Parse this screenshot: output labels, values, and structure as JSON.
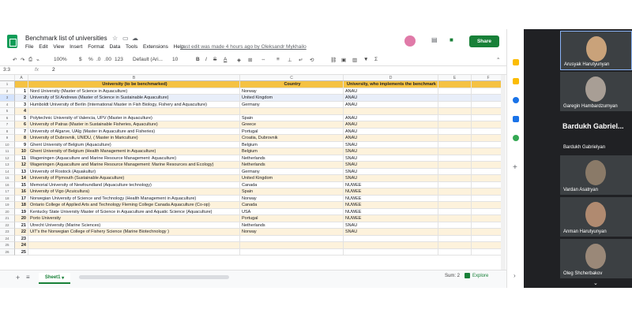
{
  "app": {
    "title": "Benchmark list of universities",
    "menus": [
      "File",
      "Edit",
      "View",
      "Insert",
      "Format",
      "Data",
      "Tools",
      "Extensions",
      "Help"
    ],
    "last_edit": "Last edit was made 4 hours ago by Oleksandr Mykhailo",
    "share_label": "Share"
  },
  "toolbar": {
    "zoom": "100%",
    "currency": "$",
    "percent": "%",
    "decimal_less": ".0",
    "decimal_more": ".00",
    "number_format": "123",
    "font": "Default (Ari...",
    "font_size": "10"
  },
  "formula": {
    "name_box": "3:3",
    "fx": "fx",
    "value": "2"
  },
  "columns": [
    "A",
    "B",
    "C",
    "D",
    "E",
    "F"
  ],
  "header": {
    "b": "University (to be benchmarked)",
    "c": "Country",
    "d": "University, who implements the benchmark"
  },
  "rows": [
    {
      "r": "2",
      "n": "1",
      "b": "Nord University (Master of Science in Aquaculture)",
      "c": "Norway",
      "d": "ANAU"
    },
    {
      "r": "3",
      "n": "2",
      "b": "University of St Andrews (Master of Science in Sustainable Aquaculture)",
      "c": "United Kingdom",
      "d": "ANAU"
    },
    {
      "r": "4",
      "n": "3",
      "b": "Humboldt University of Berlin (International Master in Fish Biology, Fishery and Aquaculture)",
      "c": "Germany",
      "d": "ANAU"
    },
    {
      "r": "5",
      "n": "4",
      "b": "",
      "c": "",
      "d": ""
    },
    {
      "r": "6",
      "n": "5",
      "b": "Polytechnic University of Valencia, UPV (Master in Aquaculture)",
      "c": "Spain",
      "d": "ANAU"
    },
    {
      "r": "7",
      "n": "6",
      "b": "University of Patras (Master in Sustainable Fisheries, Aquaculture)",
      "c": "Greece",
      "d": "ANAU"
    },
    {
      "r": "8",
      "n": "7",
      "b": "University of Algarve, UAlg (Master in Aquaculture and Fisheries)",
      "c": "Portugal",
      "d": "ANAU"
    },
    {
      "r": "9",
      "n": "8",
      "b": "University of Dubrovnik, UNIDU, ( Master in Mariculture)",
      "c": "Croatia, Dubrovnik",
      "d": "ANAU"
    },
    {
      "r": "10",
      "n": "9",
      "b": "Ghent University of Belgium (Aquaculture)",
      "c": "Belgium",
      "d": "SNAU"
    },
    {
      "r": "11",
      "n": "10",
      "b": "Ghent University of Belgium (Health Management in Aquaculture)",
      "c": "Belgium",
      "d": "SNAU"
    },
    {
      "r": "12",
      "n": "11",
      "b": "Wageningen (Aquaculture and Marine Resource Management: Aquaculture)",
      "c": "Netherlands",
      "d": "SNAU"
    },
    {
      "r": "13",
      "n": "12",
      "b": "Wageningen (Aquaculture and Marine Resource Management: Marine Resources and Ecology)",
      "c": "Netherlands",
      "d": "SNAU"
    },
    {
      "r": "14",
      "n": "13",
      "b": "University of Rostock (Aquakultur)",
      "c": "Germany",
      "d": "SNAU"
    },
    {
      "r": "15",
      "n": "14",
      "b": "University of Plymouth (Sustainable Aquaculture)",
      "c": "United Kingdom",
      "d": "SNAU"
    },
    {
      "r": "16",
      "n": "15",
      "b": "Memorial University of Newfoundland (Aquaculture technology)",
      "c": "Canada",
      "d": "NUWEE"
    },
    {
      "r": "17",
      "n": "16",
      "b": "University of Vigo (Acuicultura)",
      "c": "Spain",
      "d": "NUWEE"
    },
    {
      "r": "18",
      "n": "17",
      "b": "Norwegian University of Science and Technology (Health Management in Aquaculture)",
      "c": "Norway",
      "d": "NUWEE"
    },
    {
      "r": "19",
      "n": "18",
      "b": "Ontario College of Applied Arts and Technology Fleming College Canada Aquaculture (Co-op)",
      "c": "Canada",
      "d": "NUWEE"
    },
    {
      "r": "20",
      "n": "19",
      "b": "Kentucky State University Master of Science in Aquaculture and Aquatic Science (Aquaculture)",
      "c": "USA",
      "d": "NUWEE"
    },
    {
      "r": "21",
      "n": "20",
      "b": "Porto University",
      "c": "Portugal",
      "d": "NUWEE"
    },
    {
      "r": "22",
      "n": "21",
      "b": "Utrecht University (Marine Sciences)",
      "c": "Netherlands",
      "d": "SNAU"
    },
    {
      "r": "23",
      "n": "22",
      "b": "UiT's the Norwegian College of Fishery Science (Marine Biotechnology )",
      "c": "Norway",
      "d": "SNAU"
    },
    {
      "r": "24",
      "n": "23",
      "b": "",
      "c": "",
      "d": ""
    },
    {
      "r": "25",
      "n": "24",
      "b": "",
      "c": "",
      "d": ""
    },
    {
      "r": "26",
      "n": "25",
      "b": "",
      "c": "",
      "d": ""
    }
  ],
  "sheet": {
    "tab": "Sheet1",
    "sum": "Sum: 2",
    "explore": "Explore"
  },
  "participants": [
    {
      "name": "Arusyak Harutyunyan",
      "color": "#c9a27a"
    },
    {
      "name": "Garegin Hambardzumyan",
      "color": "#a89e95"
    },
    {
      "name": "Bardukh Gabrielyan",
      "big": "Bardukh Gabriel..."
    },
    {
      "name": "Vardan Asatryan",
      "color": "#8a7a68"
    },
    {
      "name": "Anman Harutyunyan",
      "color": "#b08a70"
    },
    {
      "name": "Oleg Shcherbakov",
      "color": "#9a8878"
    }
  ]
}
